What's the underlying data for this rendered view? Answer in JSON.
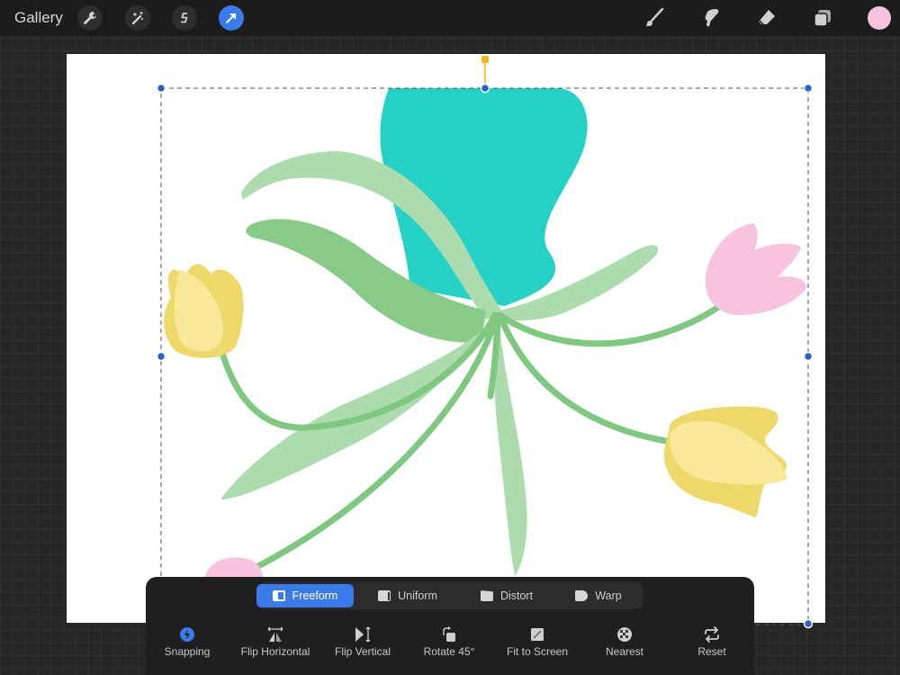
{
  "topbar": {
    "gallery_label": "Gallery",
    "left_tools": [
      {
        "name": "actions",
        "icon": "wrench-icon"
      },
      {
        "name": "adjustments",
        "icon": "magic-wand-icon"
      },
      {
        "name": "selection",
        "icon": "selection-s-icon"
      },
      {
        "name": "transform",
        "icon": "transform-arrow-icon",
        "active": true
      }
    ],
    "right_tools": [
      {
        "name": "brush",
        "icon": "brush-icon"
      },
      {
        "name": "smudge",
        "icon": "smudge-icon"
      },
      {
        "name": "eraser",
        "icon": "eraser-icon"
      },
      {
        "name": "layers",
        "icon": "layers-icon"
      }
    ],
    "current_color": "#f7c3df",
    "accent_color": "#3a7bec"
  },
  "canvas": {
    "artwork": "flowers-illustration",
    "colors": {
      "teal": "#25d1c5",
      "leaf_light": "#acdcae",
      "leaf_dark": "#87cb86",
      "stem": "#7ec87f",
      "yellow_light": "#f7e89a",
      "yellow_dark": "#eed86a",
      "pink": "#f7c3df"
    },
    "selection": {
      "handle_color": "#2a62c9",
      "rotate_handle_color": "#f0b81c"
    }
  },
  "transform_panel": {
    "modes": [
      {
        "label": "Freeform",
        "active": true
      },
      {
        "label": "Uniform",
        "active": false
      },
      {
        "label": "Distort",
        "active": false
      },
      {
        "label": "Warp",
        "active": false
      }
    ],
    "tools": [
      {
        "label": "Snapping",
        "icon": "snapping-icon"
      },
      {
        "label": "Flip Horizontal",
        "icon": "flip-horizontal-icon"
      },
      {
        "label": "Flip Vertical",
        "icon": "flip-vertical-icon"
      },
      {
        "label": "Rotate 45°",
        "icon": "rotate-icon"
      },
      {
        "label": "Fit to Screen",
        "icon": "fit-to-screen-icon"
      },
      {
        "label": "Nearest",
        "icon": "nearest-icon"
      },
      {
        "label": "Reset",
        "icon": "reset-icon"
      }
    ]
  }
}
